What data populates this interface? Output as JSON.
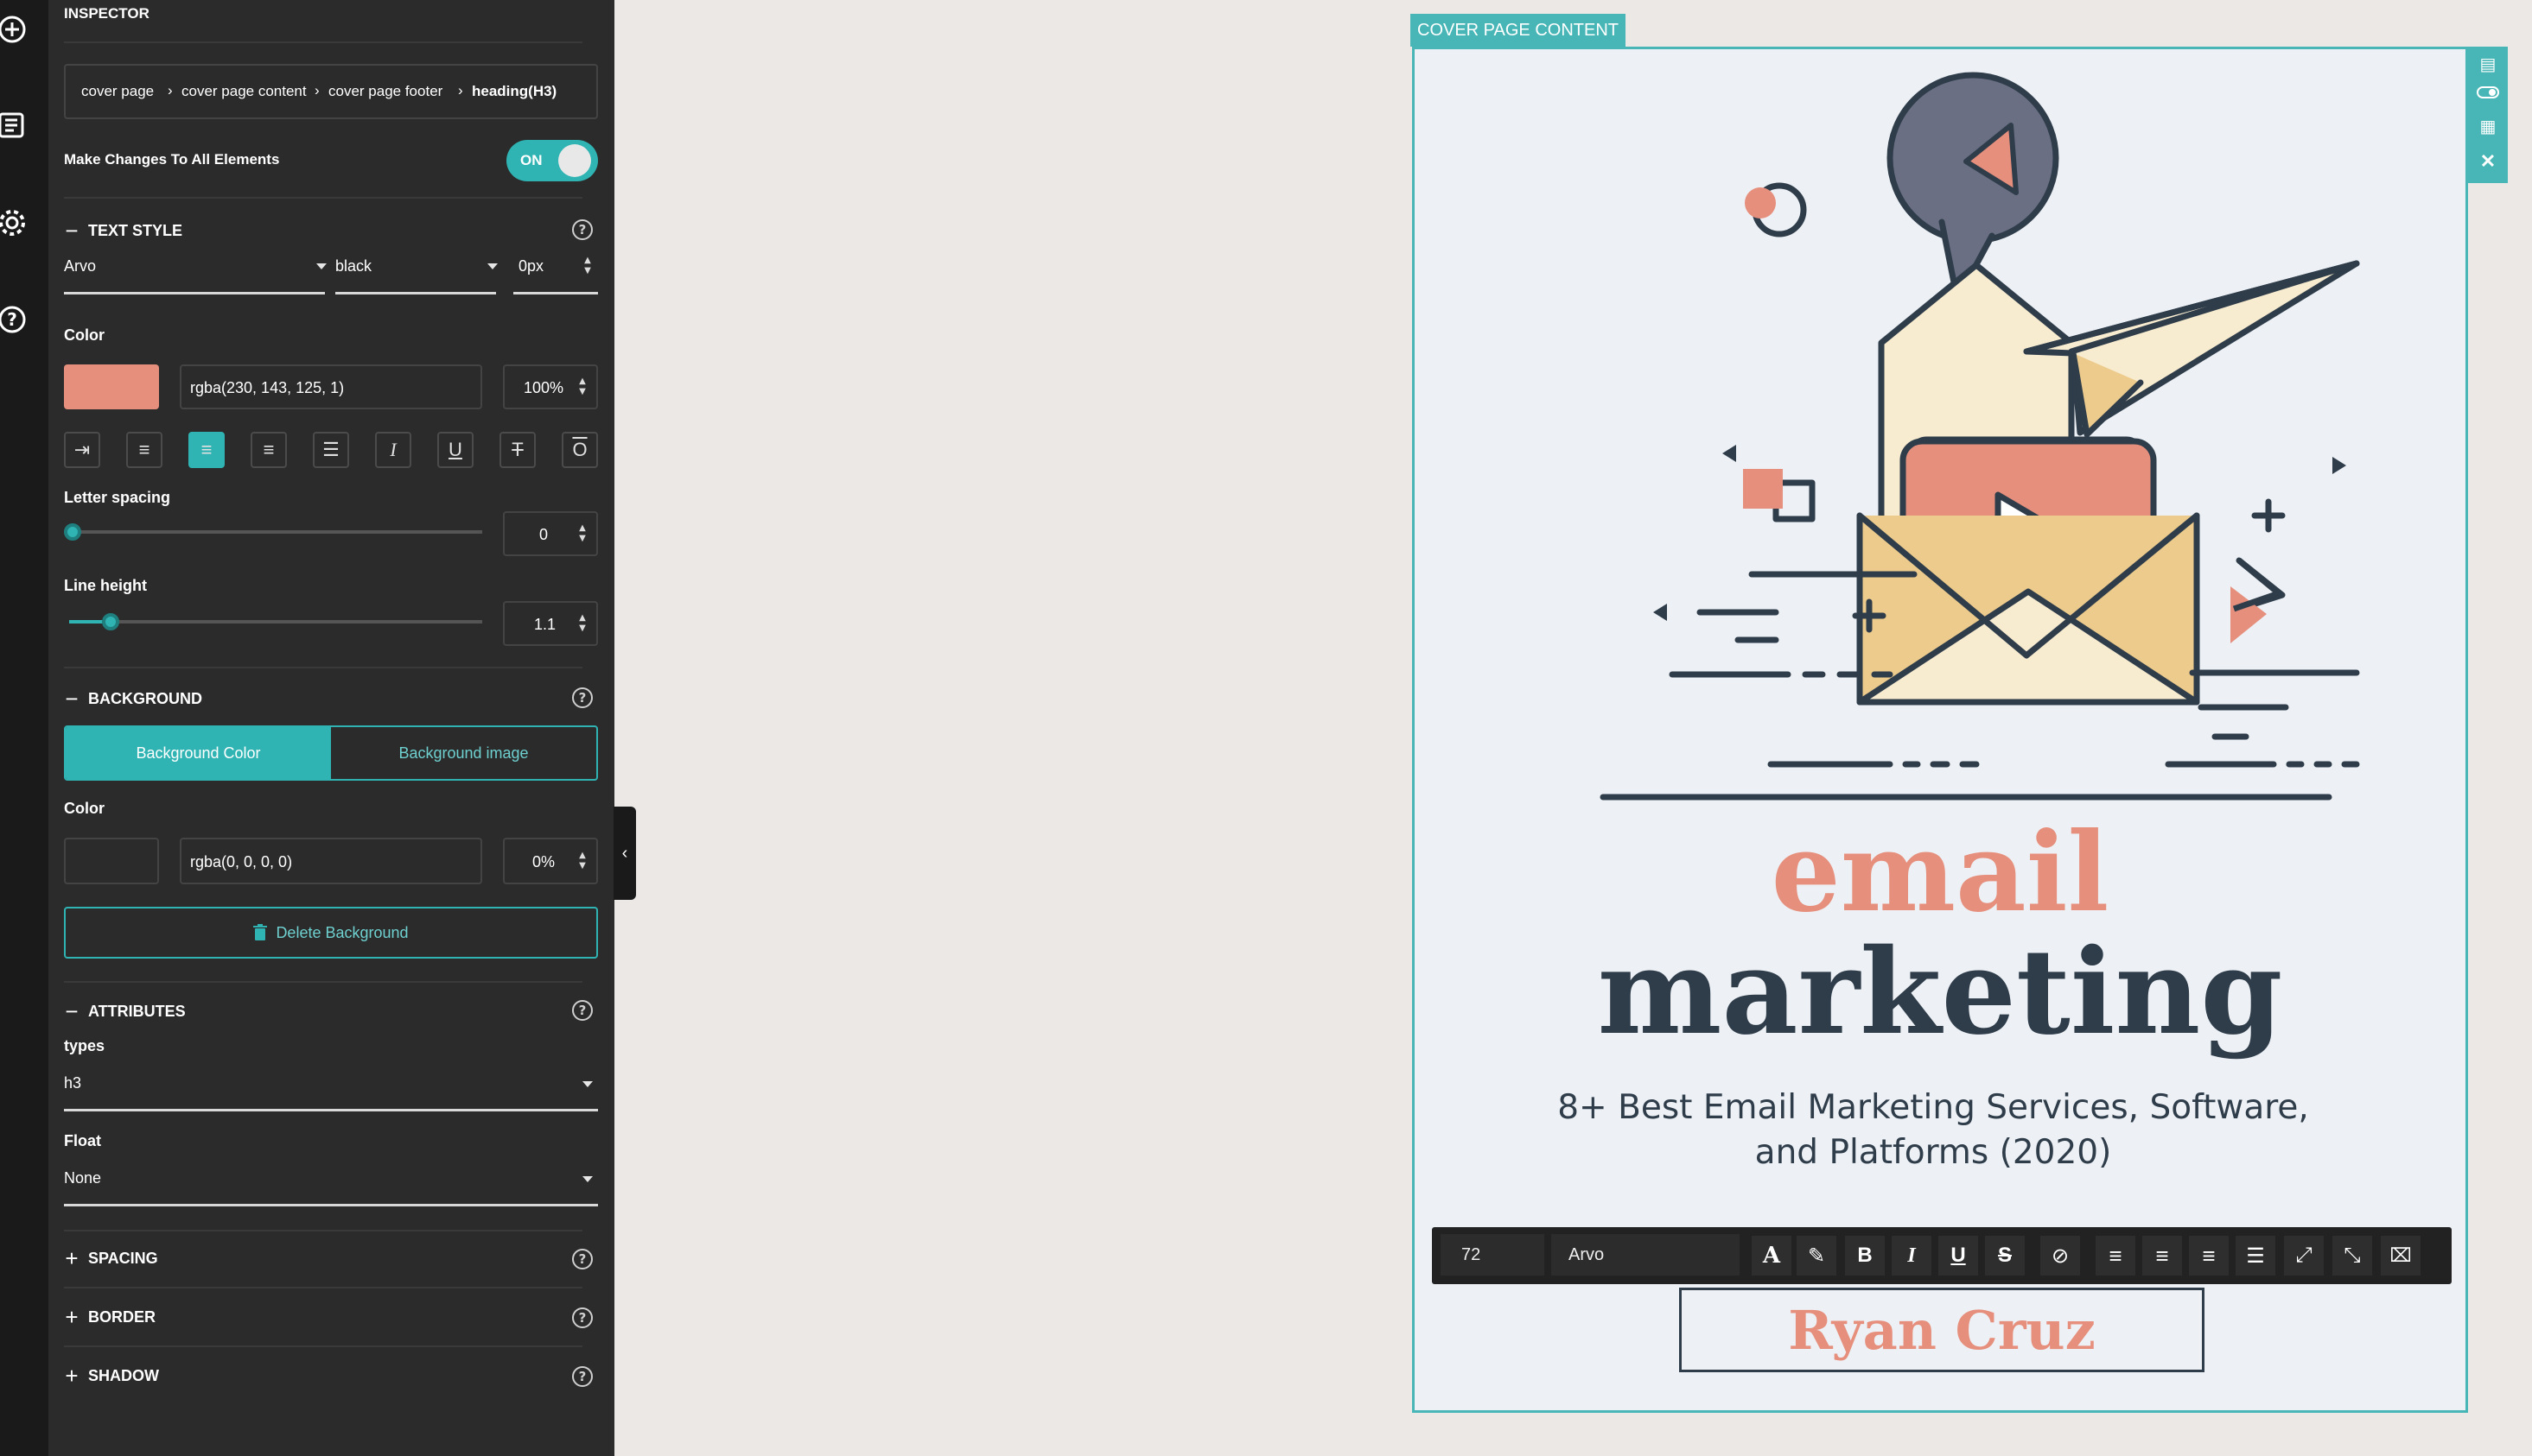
{
  "rail": {
    "icons": [
      "add-icon",
      "pages-icon",
      "settings-icon",
      "help-icon"
    ]
  },
  "inspector": {
    "title": "INSPECTOR",
    "breadcrumb": [
      "cover page",
      "cover page content",
      "cover page footer",
      "heading(H3)"
    ],
    "make_changes": {
      "label": "Make Changes To All Elements",
      "toggle": "ON"
    },
    "text_style": {
      "title": "TEXT STYLE",
      "font": "Arvo",
      "weight": "black",
      "size": "0px",
      "color_label": "Color",
      "color_value": "rgba(230, 143, 125, 1)",
      "color_opacity": "100%",
      "color_swatch": "#e68f7d",
      "letter_spacing_label": "Letter spacing",
      "letter_spacing": "0",
      "line_height_label": "Line height",
      "line_height": "1.1"
    },
    "background": {
      "title": "BACKGROUND",
      "tab_color": "Background Color",
      "tab_image": "Background image",
      "color_label": "Color",
      "color_value": "rgba(0, 0, 0, 0)",
      "opacity": "0%",
      "delete_label": "Delete Background"
    },
    "attributes": {
      "title": "ATTRIBUTES",
      "types_label": "types",
      "types_value": "h3",
      "float_label": "Float",
      "float_value": "None"
    },
    "spacing_title": "SPACING",
    "border_title": "BORDER",
    "shadow_title": "SHADOW"
  },
  "canvas": {
    "tag": "COVER PAGE CONTENT",
    "heading1": "email",
    "heading2": "marketing",
    "subtitle": "8+ Best Email Marketing Services, Software, and Platforms (2020)",
    "author": "Ryan Cruz",
    "toolbar": {
      "size": "72",
      "font": "Arvo"
    }
  },
  "colors": {
    "accent": "#2fb3b3",
    "salmon": "#e68f7d",
    "navy": "#2f3c4a",
    "yellow": "#eccb8c",
    "cream": "#f8ecd0"
  }
}
